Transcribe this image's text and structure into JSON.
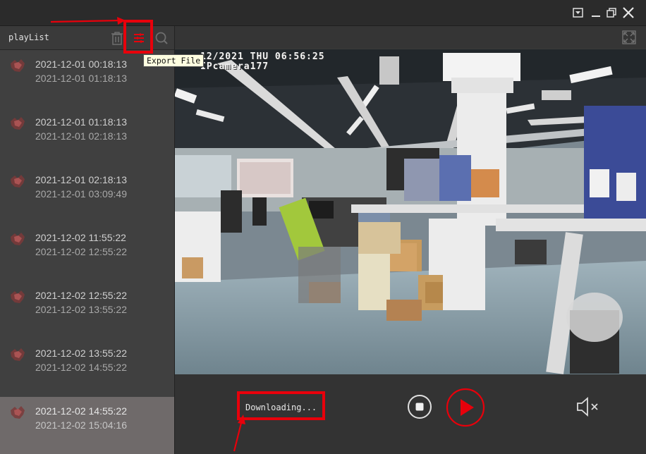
{
  "sidebar": {
    "title": "playList",
    "tooltip": "Export File",
    "items": [
      {
        "start": "2021-12-01 00:18:13",
        "end": "2021-12-01 01:18:13"
      },
      {
        "start": "2021-12-01 01:18:13",
        "end": "2021-12-01 02:18:13"
      },
      {
        "start": "2021-12-01 02:18:13",
        "end": "2021-12-01 03:09:49"
      },
      {
        "start": "2021-12-02 11:55:22",
        "end": "2021-12-02 12:55:22"
      },
      {
        "start": "2021-12-02 12:55:22",
        "end": "2021-12-02 13:55:22"
      },
      {
        "start": "2021-12-02 13:55:22",
        "end": "2021-12-02 14:55:22"
      },
      {
        "start": "2021-12-02 14:55:22",
        "end": "2021-12-02 15:04:16"
      }
    ],
    "selected_index": 6
  },
  "video": {
    "osd_datetime": "12/2021 THU 06:56:25",
    "osd_camera": "IPcamera177"
  },
  "controls": {
    "status": "Downloading..."
  },
  "colors": {
    "accent": "#e8000b",
    "selected_row": "#6f6a6a"
  },
  "icons": [
    "minimize-icon",
    "restore-icon",
    "close-icon",
    "dropdown-icon",
    "trash-icon",
    "menu-lines-icon",
    "search-icon",
    "fullscreen-icon",
    "stop-icon",
    "play-icon",
    "mute-icon",
    "video-thumbnail-icon"
  ]
}
